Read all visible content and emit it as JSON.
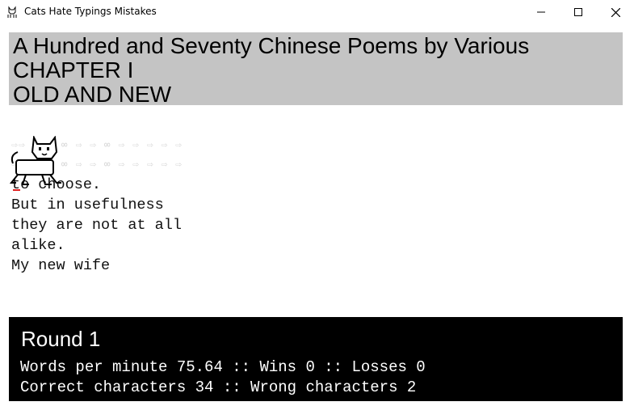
{
  "window": {
    "title": "Cats Hate Typings Mistakes",
    "icon": "cat-icon",
    "controls": [
      "minimize-icon",
      "maximize-icon",
      "close-icon"
    ]
  },
  "header": {
    "book_title": "A Hundred and Seventy Chinese Poems by Various",
    "chapter": "CHAPTER I",
    "chapter_title": "OLD AND NEW"
  },
  "passage": {
    "lines": [
      "to choose.",
      "But in usefulness",
      "they are not at all",
      "alike.",
      "My new wife"
    ]
  },
  "stats": {
    "round_label": "Round 1",
    "line1": "Words per minute 75.64 :: Wins 0 :: Losses 0",
    "line2": "Correct characters 34 :: Wrong characters 2"
  },
  "colors": {
    "header_bg": "#c4c4c4",
    "footer_bg": "#000000",
    "error_mark": "#e02020"
  }
}
